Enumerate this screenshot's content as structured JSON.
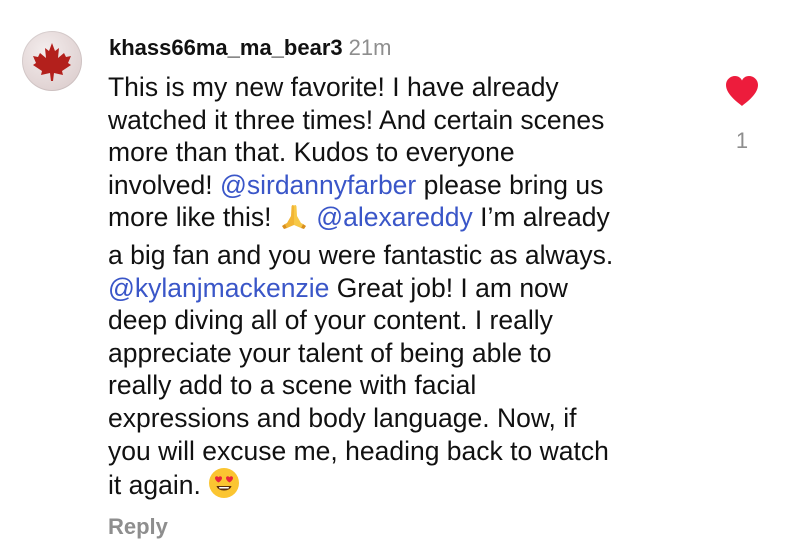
{
  "comment": {
    "username": "khass66ma_ma_bear3",
    "time": "21m",
    "avatar_icon": "maple-leaf-icon",
    "lines": [
      [
        {
          "t": "This is my new favorite! I have already"
        }
      ],
      [
        {
          "t": "watched it three times! And certain scenes"
        }
      ],
      [
        {
          "t": "more than that. Kudos to everyone"
        }
      ],
      [
        {
          "t": "involved! "
        },
        {
          "t": "@sirdannyfarber",
          "mention": true
        },
        {
          "t": " please bring us"
        }
      ],
      [
        {
          "t": "more like this! "
        },
        {
          "emoji": "folded-hands-icon"
        },
        {
          "t": " "
        },
        {
          "t": "@alexareddy",
          "mention": true
        },
        {
          "t": " I’m already"
        }
      ],
      [
        {
          "t": "a big fan and you were fantastic as always."
        }
      ],
      [
        {
          "t": "@kylanjmackenzie",
          "mention": true
        },
        {
          "t": " Great job! I am now"
        }
      ],
      [
        {
          "t": "deep diving all of your content. I really"
        }
      ],
      [
        {
          "t": "appreciate your talent of being able to"
        }
      ],
      [
        {
          "t": "really add to a scene with facial"
        }
      ],
      [
        {
          "t": "expressions and body language. Now, if"
        }
      ],
      [
        {
          "t": "you will excuse me, heading back to watch"
        }
      ],
      [
        {
          "t": "it again. "
        },
        {
          "emoji": "heart-eyes-emoji-icon"
        }
      ]
    ],
    "reply_label": "Reply",
    "like": {
      "icon": "heart-icon",
      "count": "1",
      "liked": true,
      "color": "#ed1c3c"
    }
  },
  "colors": {
    "mention": "#3a56c8",
    "secondary_text": "#8e8e8e",
    "text": "#111111"
  }
}
